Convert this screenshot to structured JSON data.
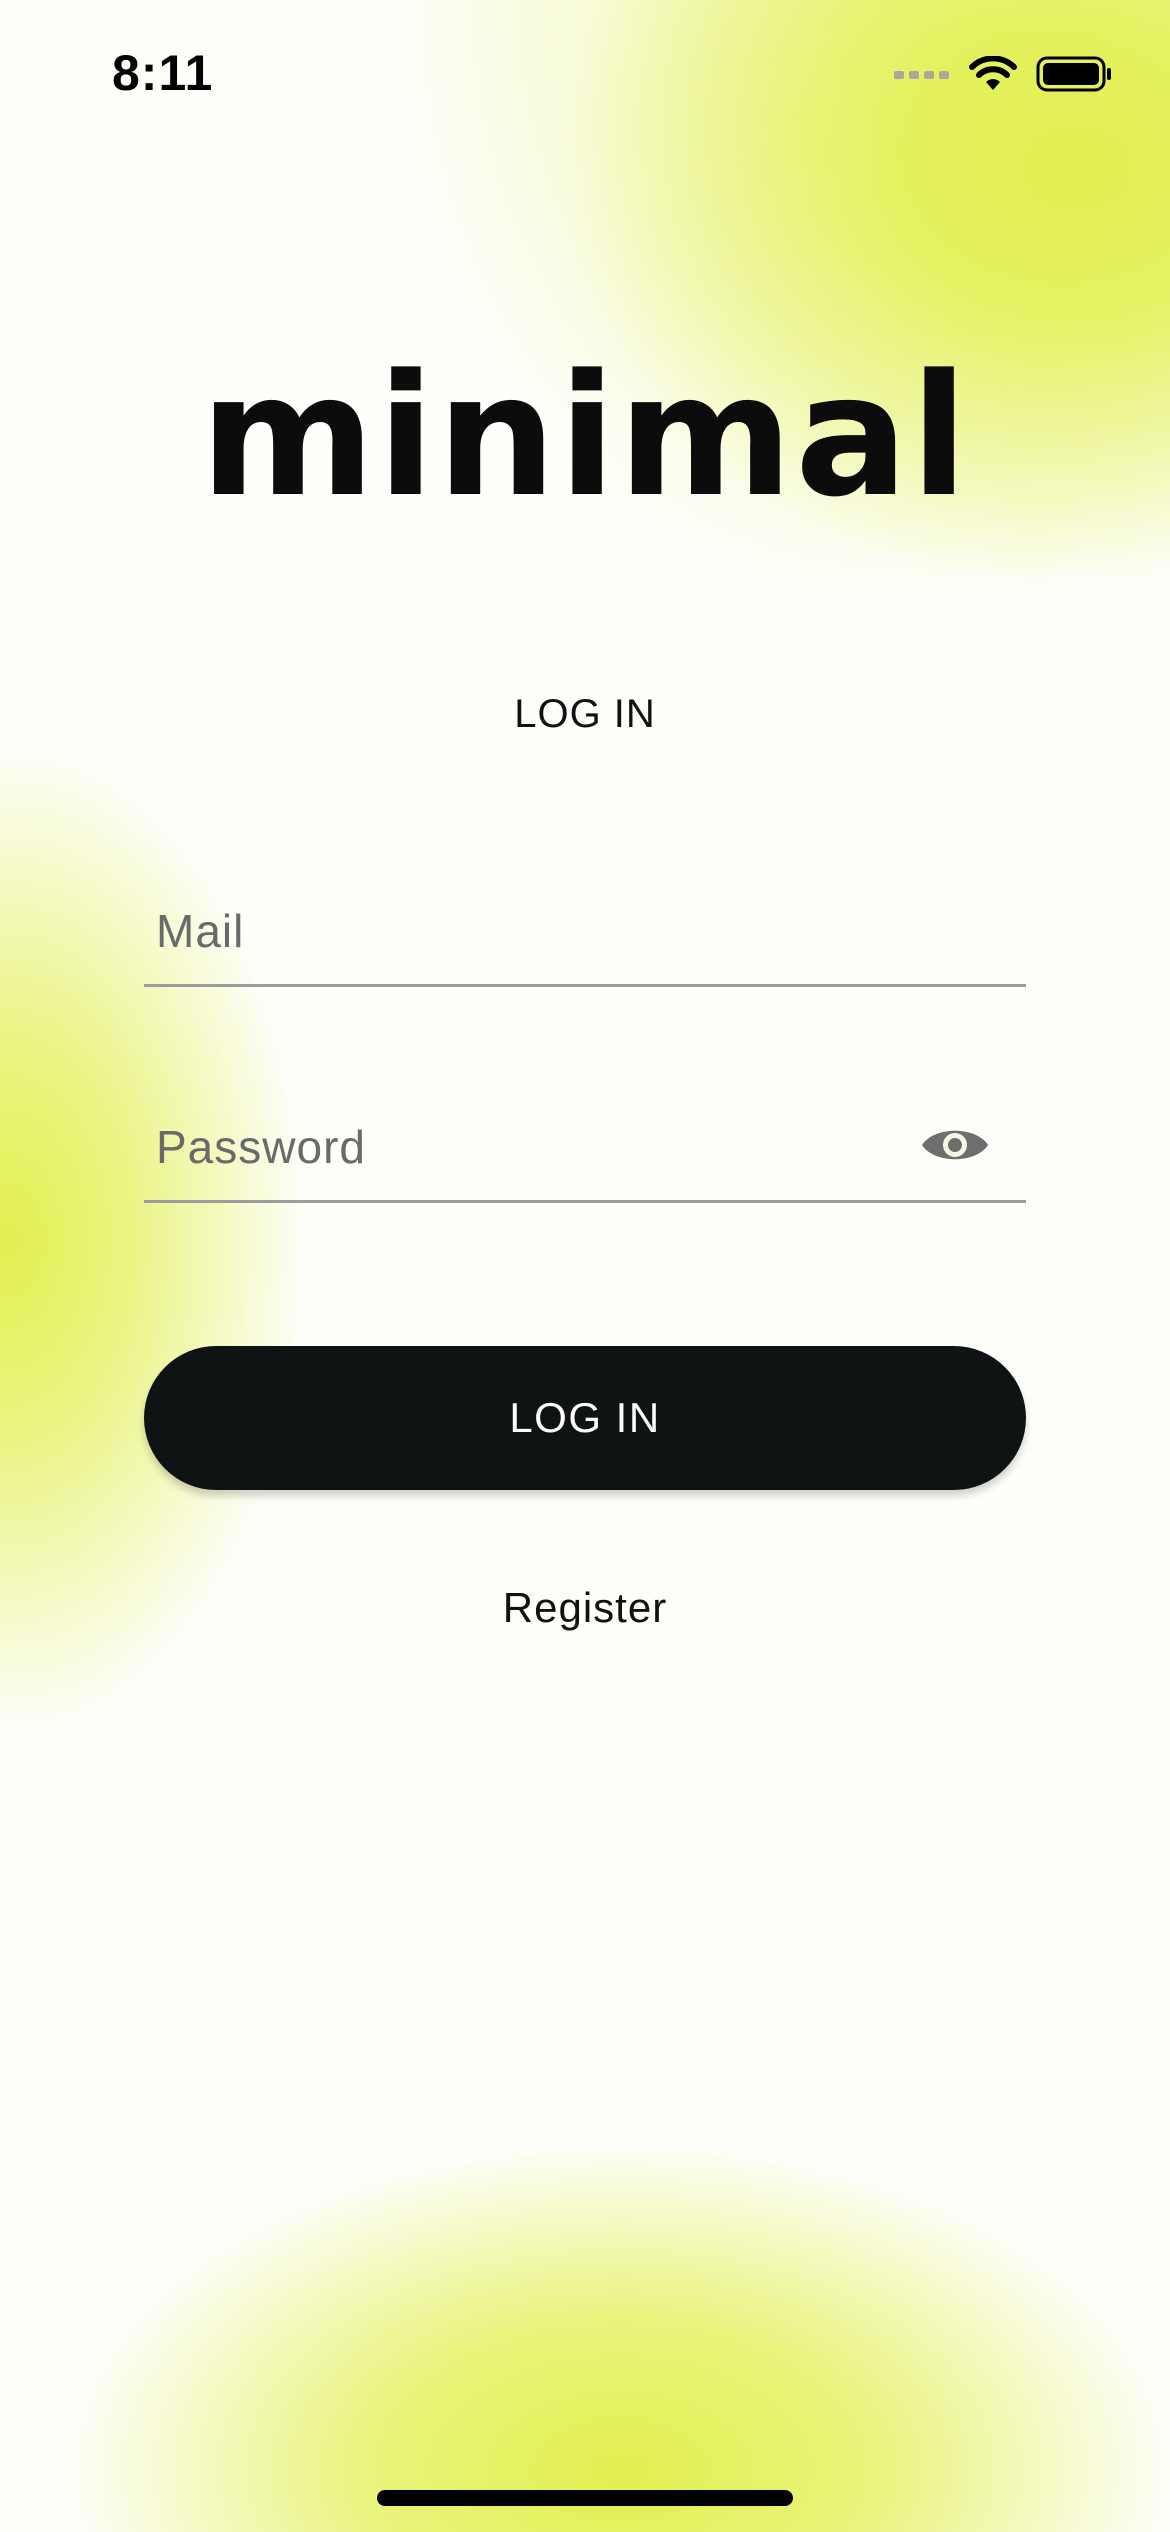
{
  "status_bar": {
    "time": "8:11"
  },
  "brand": {
    "logo_text": "minimal"
  },
  "screen": {
    "title": "LOG IN"
  },
  "form": {
    "mail_placeholder": "Mail",
    "password_placeholder": "Password",
    "submit_label": "LOG IN",
    "register_label": "Register"
  },
  "colors": {
    "accent": "#E2F050",
    "button": "#101314",
    "text": "#111111"
  },
  "icons": {
    "password_toggle": "eye-icon",
    "signal": "cellular-signal-icon",
    "wifi": "wifi-icon",
    "battery": "battery-icon"
  }
}
